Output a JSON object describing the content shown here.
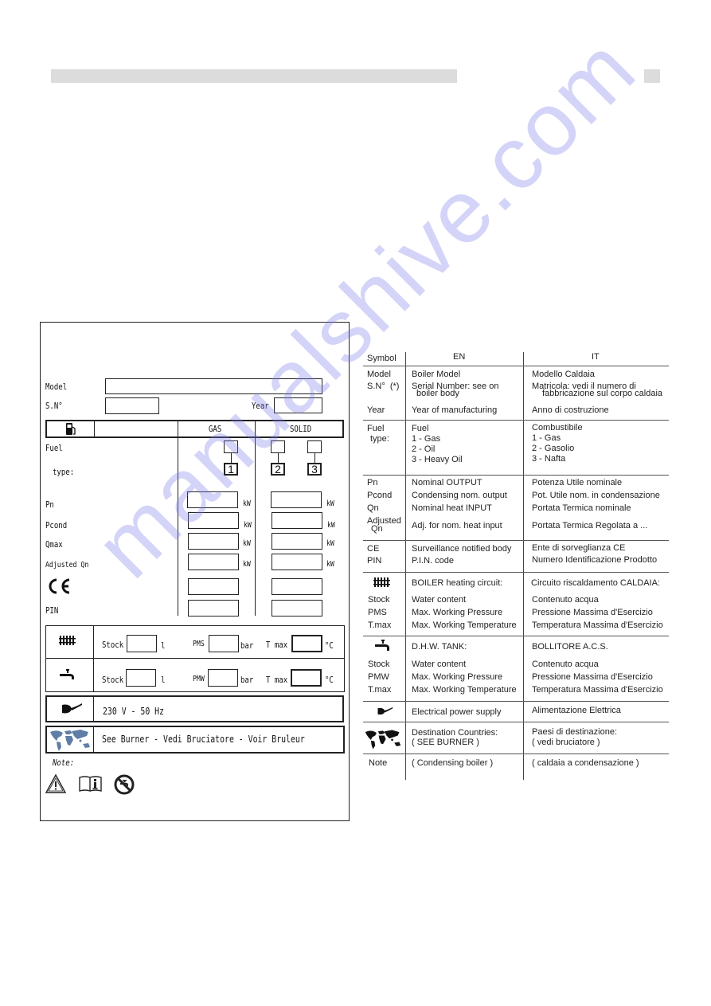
{
  "page": {
    "header_bar_present": true
  },
  "nameplate": {
    "model_label": "Model",
    "sn_label": "S.N°",
    "year_label": "Year",
    "fuel_header_gas": "GAS",
    "fuel_header_solid": "SOLID",
    "fuel_label": "Fuel",
    "type_label": "type:",
    "fuel_numbers": [
      "1",
      "2",
      "3"
    ],
    "rows": [
      {
        "label": "Pn",
        "unit": "kW"
      },
      {
        "label": "Pcond",
        "unit": "kW"
      },
      {
        "label": "Qmax",
        "unit": "kW"
      },
      {
        "label": "Adjusted Qn",
        "unit": "kW"
      },
      {
        "label": "CE",
        "unit": ""
      },
      {
        "label": "PIN",
        "unit": ""
      }
    ],
    "heating": {
      "stock_label": "Stock",
      "stock_unit": "l",
      "pressure_label": "PMS",
      "pressure_unit": "bar",
      "tmax_label": "T max",
      "tmax_unit": "°C"
    },
    "dhw": {
      "stock_label": "Stock",
      "stock_unit": "l",
      "pressure_label": "PMW",
      "pressure_unit": "bar",
      "tmax_label": "T max",
      "tmax_unit": "°C"
    },
    "power_supply": "230 V - 50 Hz",
    "destination": "See Burner - Vedi Bruciatore - Voir Bruleur",
    "note_label": "Note:",
    "icons": [
      "fuel-pump-icon",
      "radiator-icon",
      "tap-icon",
      "plug-icon",
      "world-map-icon",
      "warning-icon",
      "manual-info-icon",
      "no-drinking-water-icon"
    ]
  },
  "legend": {
    "headers": {
      "symbol": "Symbol",
      "en": "EN",
      "it": "IT"
    },
    "rows": [
      {
        "symbol": "Model",
        "en": "Boiler Model",
        "it": "Modello Caldaia"
      },
      {
        "symbol": "S.N°  (*)",
        "en": "Serial Number: see on",
        "en2": "boiler body",
        "it": "Matricola: vedi il numero di",
        "it2": "fabbricazione sul corpo caldaia"
      },
      {
        "symbol": "Year",
        "en": "Year of manufacturing",
        "it": "Anno di costruzione"
      },
      {
        "symbol": "Fuel",
        "symbol2": "type:",
        "en": "Fuel",
        "en_list": [
          "1 - Gas",
          "2 - Oil",
          "3 - Heavy Oil"
        ],
        "it": "Combustibile",
        "it_list": [
          "1 - Gas",
          "2 - Gasolio",
          "3 - Nafta"
        ]
      },
      {
        "symbol": "Pn",
        "en": "Nominal OUTPUT",
        "it": "Potenza Utile nominale"
      },
      {
        "symbol": "Pcond",
        "en": "Condensing nom. output",
        "it": "Pot. Utile nom. in condensazione"
      },
      {
        "symbol": "Qn",
        "en": "Nominal heat INPUT",
        "it": "Portata Termica nominale"
      },
      {
        "symbol": "Adjusted",
        "symbol2": "Qn",
        "en": "Adj. for nom. heat input",
        "it": "Portata Termica Regolata a ..."
      },
      {
        "symbol": "CE",
        "en": "Surveillance notified body",
        "it": "Ente di sorveglianza CE"
      },
      {
        "symbol": "PIN",
        "en": "P.I.N. code",
        "it": "Numero Identificazione Prodotto"
      },
      {
        "symbol": "radiator-icon",
        "en": "BOILER heating circuit:",
        "it": "Circuito riscaldamento CALDAIA:"
      },
      {
        "symbol": "Stock",
        "en": "Water content",
        "it": "Contenuto acqua"
      },
      {
        "symbol": "PMS",
        "en": "Max. Working Pressure",
        "it": "Pressione Massima d'Esercizio"
      },
      {
        "symbol": "T.max",
        "en": "Max. Working Temperature",
        "it": "Temperatura Massima d'Esercizio"
      },
      {
        "symbol": "tap-icon",
        "en": "D.H.W. TANK:",
        "it": "BOLLITORE A.C.S."
      },
      {
        "symbol": "Stock",
        "en": "Water content",
        "it": "Contenuto acqua"
      },
      {
        "symbol": "PMW",
        "en": "Max. Working Pressure",
        "it": "Pressione Massima d'Esercizio"
      },
      {
        "symbol": "T.max",
        "en": "Max. Working Temperature",
        "it": "Temperatura Massima d'Esercizio"
      },
      {
        "symbol": "plug-icon",
        "en": "Electrical power supply",
        "it": "Alimentazione Elettrica"
      },
      {
        "symbol": "world-map-icon",
        "en": "Destination Countries:",
        "en2": "( SEE BURNER )",
        "it": "Paesi di destinazione:",
        "it2": "( vedi bruciatore )"
      },
      {
        "symbol": "Note",
        "en": "( Condensing boiler )",
        "it": "( caldaia a condensazione )"
      }
    ]
  },
  "watermark": "manualshive.com"
}
